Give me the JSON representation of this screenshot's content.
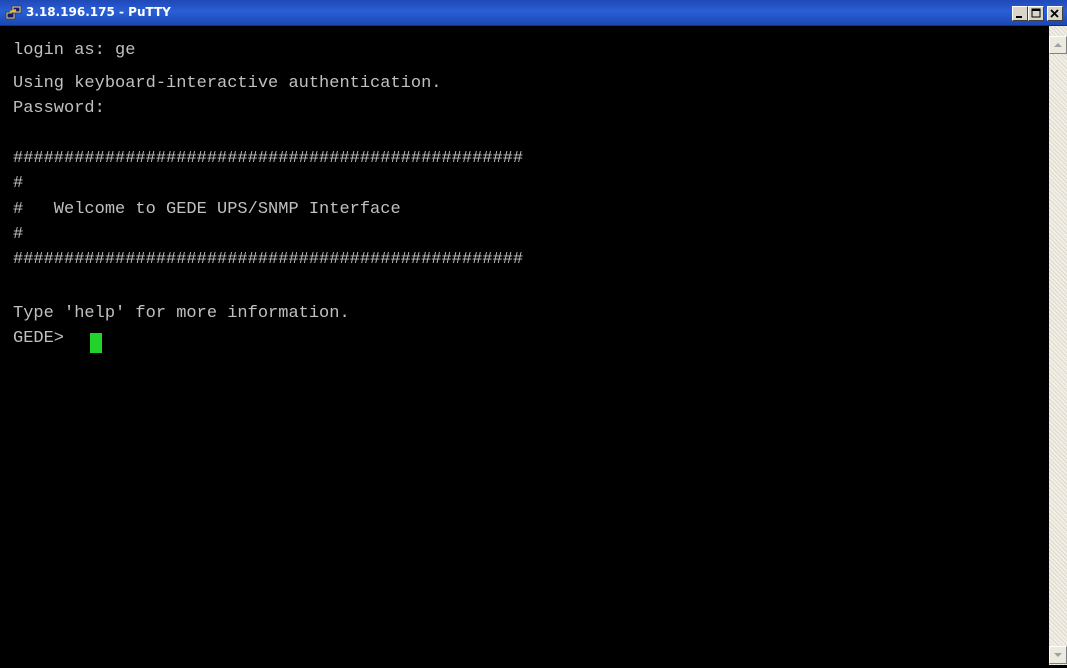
{
  "window": {
    "title": "3.18.196.175 - PuTTY",
    "icon": "putty-icon",
    "controls": {
      "minimize_icon": "minimize-icon",
      "maximize_icon": "maximize-icon",
      "close_icon": "close-icon"
    }
  },
  "terminal": {
    "lines": [
      "login as: ge",
      "Using keyboard-interactive authentication.",
      "Password:",
      "",
      "##################################################",
      "#",
      "#   Welcome to GEDE UPS/SNMP Interface",
      "#",
      "##################################################",
      "",
      "Type 'help' for more information.",
      "GEDE> "
    ],
    "text_color": "#c0c0c0",
    "background_color": "#000000",
    "cursor_color": "#22d22a"
  },
  "scrollbar": {
    "up_icon": "scroll-up-arrow-icon",
    "down_icon": "scroll-down-arrow-icon"
  }
}
